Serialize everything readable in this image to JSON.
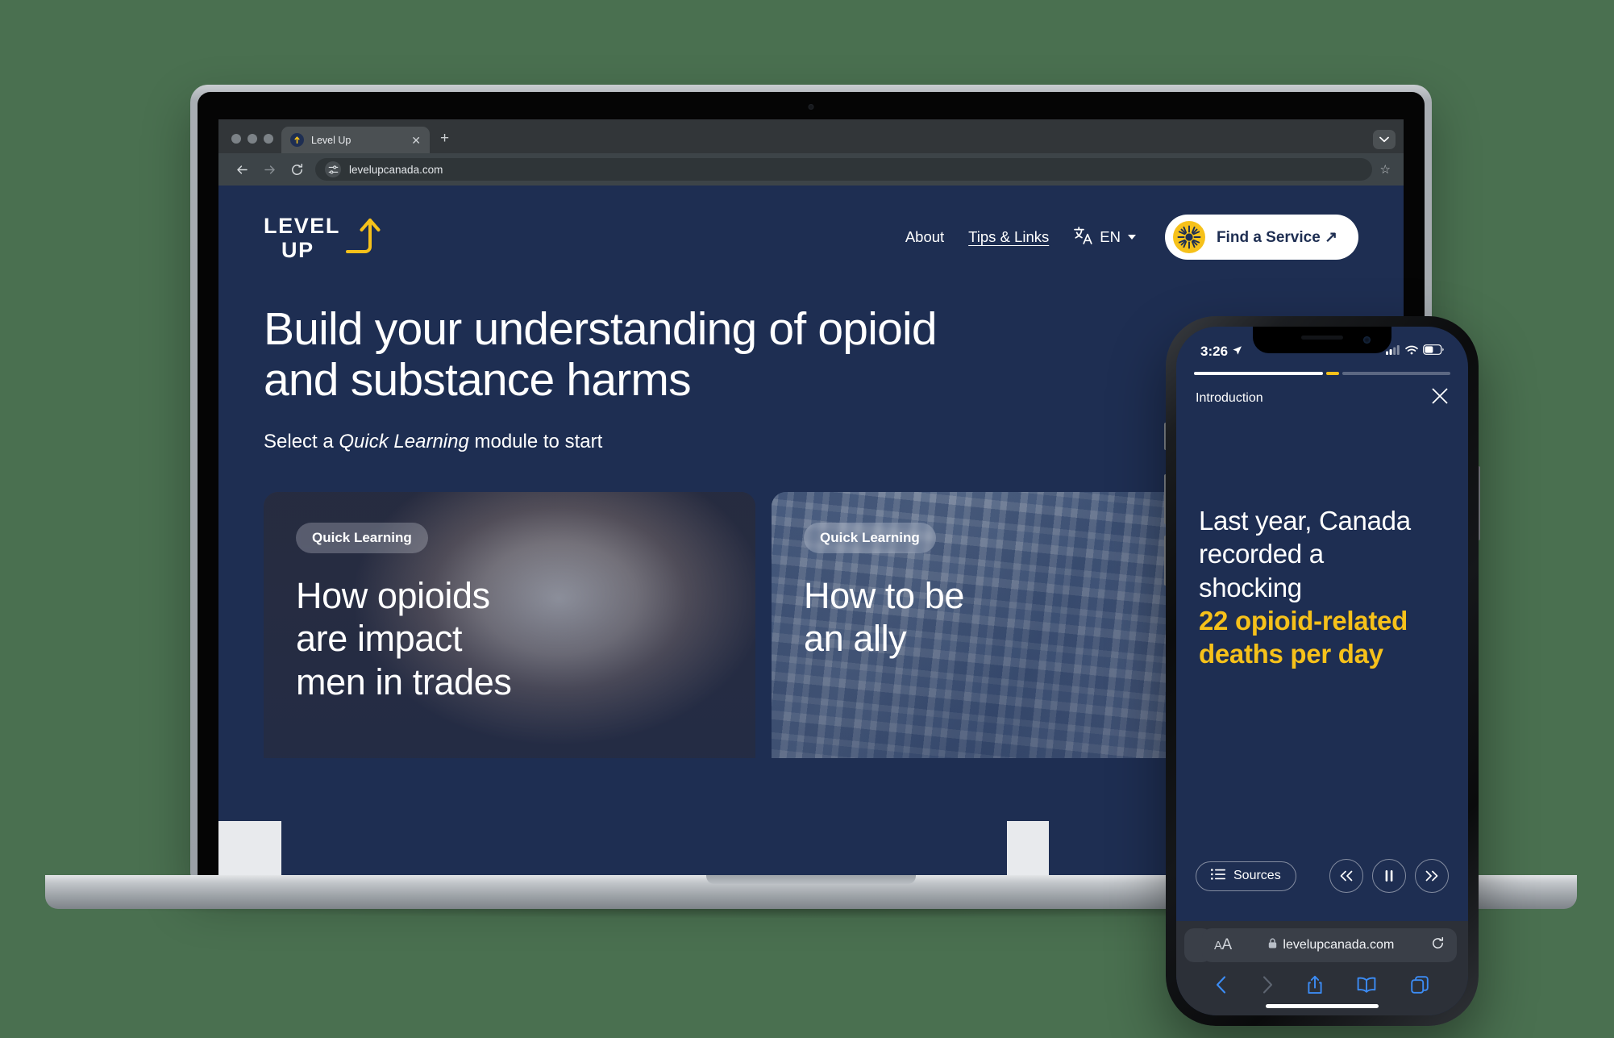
{
  "colors": {
    "page_background": "#4a7050",
    "brand_navy": "#1e2e52",
    "brand_yellow": "#f6c11a",
    "white": "#ffffff",
    "light_grey": "#e8eaed",
    "safari_blue": "#3c8cf5"
  },
  "browser": {
    "tab": {
      "title": "Level Up",
      "favicon": "up-arrow-icon",
      "close": "✕"
    },
    "new_tab": "+",
    "tabstrip_menu": "chevron-down-icon",
    "toolbar": {
      "back": "←",
      "forward": "→",
      "reload": "⟳",
      "site_settings_icon": "tune-icon",
      "url": "levelupcanada.com",
      "bookmark": "☆"
    }
  },
  "site": {
    "logo": {
      "line1": "LEVEL",
      "line2": "UP",
      "mark": "curved-up-arrow-icon"
    },
    "nav": [
      {
        "label": "About",
        "underlined": false
      },
      {
        "label": "Tips & Links",
        "underlined": true
      }
    ],
    "language": {
      "icon": "translate-icon",
      "value": "EN",
      "caret": "chevron-down-icon"
    },
    "cta": {
      "icon": "sunburst-icon",
      "label": "Find a Service ↗"
    },
    "hero": {
      "heading_line1": "Build your understanding of opioid",
      "heading_line2": "and substance harms",
      "sub_before": "Select a ",
      "sub_emphasis": "Quick Learning",
      "sub_after": " module to start"
    },
    "cards": [
      {
        "badge": "Quick Learning",
        "title_line1": "How opioids",
        "title_line2": "are impact",
        "title_line3": "men in trades",
        "photo": "man-hand-on-face-photo"
      },
      {
        "badge": "Quick Learning",
        "title_line1": "How to be",
        "title_line2": "an ally",
        "photo": "tradesmen-plaid-shirt-photo"
      }
    ]
  },
  "phone": {
    "status": {
      "time": "3:26",
      "location_icon": "location-arrow-icon",
      "cellular_icon": "cellular-bars-icon",
      "wifi_icon": "wifi-icon",
      "battery_icon": "battery-icon"
    },
    "progress": {
      "completed_pct": 42,
      "current_pct": 4,
      "remaining_pct": 54
    },
    "module": {
      "title": "Introduction",
      "close": "close-icon"
    },
    "content": {
      "line1": "Last year, Canada",
      "line2": "recorded a",
      "line3": "shocking",
      "highlight1": "22 opioid-related",
      "highlight2": "deaths per day"
    },
    "player": {
      "sources_icon": "list-icon",
      "sources_label": "Sources",
      "rewind": "«",
      "pause": "pause-icon",
      "forward": "»"
    },
    "safari": {
      "text_size": "A",
      "text_size_big": "A",
      "lock_icon": "lock-icon",
      "url": "levelupcanada.com",
      "reload_icon": "reload-icon",
      "back_icon": "chevron-left-icon",
      "forward_icon": "chevron-right-icon",
      "share_icon": "share-icon",
      "bookmarks_icon": "book-icon",
      "tabs_icon": "tabs-icon"
    }
  }
}
